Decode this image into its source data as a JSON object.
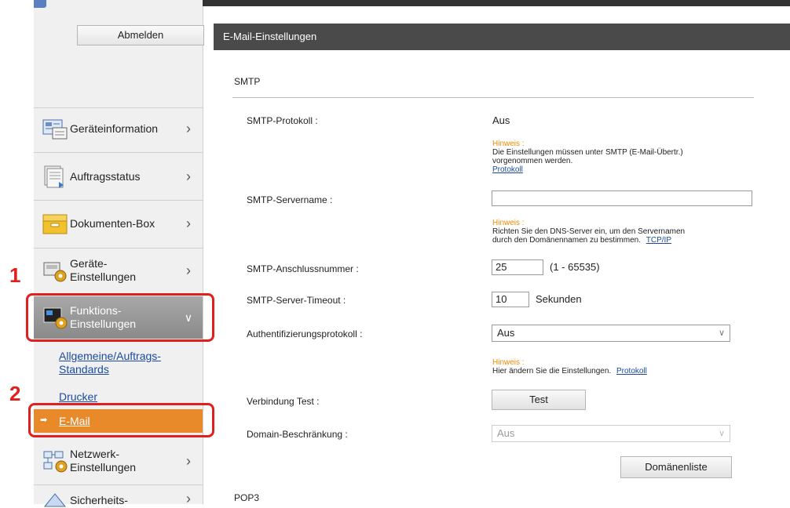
{
  "sidebar": {
    "logout_label": "Abmelden",
    "items": [
      {
        "label": "Geräteinformation",
        "icon": "device-info-icon"
      },
      {
        "label": "Auftragsstatus",
        "icon": "job-status-icon"
      },
      {
        "label": "Dokumenten-Box",
        "icon": "document-box-icon"
      },
      {
        "label": "Geräte-\nEinstellungen",
        "label_line1": "Geräte-",
        "label_line2": "Einstellungen",
        "icon": "device-settings-icon"
      },
      {
        "label_line1": "Funktions-",
        "label_line2": "Einstellungen",
        "icon": "function-settings-icon"
      },
      {
        "label_line1": "Netzwerk-",
        "label_line2": "Einstellungen",
        "icon": "network-settings-icon"
      },
      {
        "label_line1": "Sicherheits-",
        "icon": "security-settings-icon"
      }
    ],
    "subitems": [
      {
        "label_line1": "Allgemeine/Auftrags-",
        "label_line2": "Standards"
      },
      {
        "label": "Drucker"
      },
      {
        "label": "E-Mail"
      }
    ],
    "markers": [
      "1",
      "2"
    ]
  },
  "main": {
    "title": "E-Mail-Einstellungen",
    "section_smtp": "SMTP",
    "section_pop3": "POP3",
    "smtp_protocol": {
      "label": "SMTP-Protokoll :",
      "value": "Aus",
      "hint_title": "Hinweis :",
      "hint_line1": "Die Einstellungen müssen unter SMTP (E-Mail-Übertr.)",
      "hint_line2": "vorgenommen werden.",
      "hint_link": "Protokoll"
    },
    "smtp_servername": {
      "label": "SMTP-Servername :",
      "value": "",
      "hint_title": "Hinweis :",
      "hint_line1": "Richten Sie den DNS-Server ein, um den Servernamen",
      "hint_line2": "durch den Domänennamen zu bestimmen.",
      "hint_link": "TCP/IP"
    },
    "smtp_port": {
      "label": "SMTP-Anschlussnummer :",
      "value": "25",
      "range": "(1 - 65535)"
    },
    "smtp_timeout": {
      "label": "SMTP-Server-Timeout :",
      "value": "10",
      "unit": "Sekunden"
    },
    "auth_protocol": {
      "label": "Authentifizierungsprotokoll :",
      "value": "Aus",
      "hint_title": "Hinweis :",
      "hint_line1": "Hier ändern Sie die Einstellungen.",
      "hint_link": "Protokoll"
    },
    "connection_test": {
      "label": "Verbindung Test :",
      "button": "Test"
    },
    "domain_restriction": {
      "label": "Domain-Beschränkung :",
      "value": "Aus"
    },
    "domain_list_button": "Domänenliste"
  },
  "colors": {
    "accent_orange": "#e8892a",
    "highlight_red": "#e0201f",
    "header_dark": "#4a4a4a",
    "link_blue": "#1a4ba0",
    "hint_orange": "#f08a00"
  }
}
